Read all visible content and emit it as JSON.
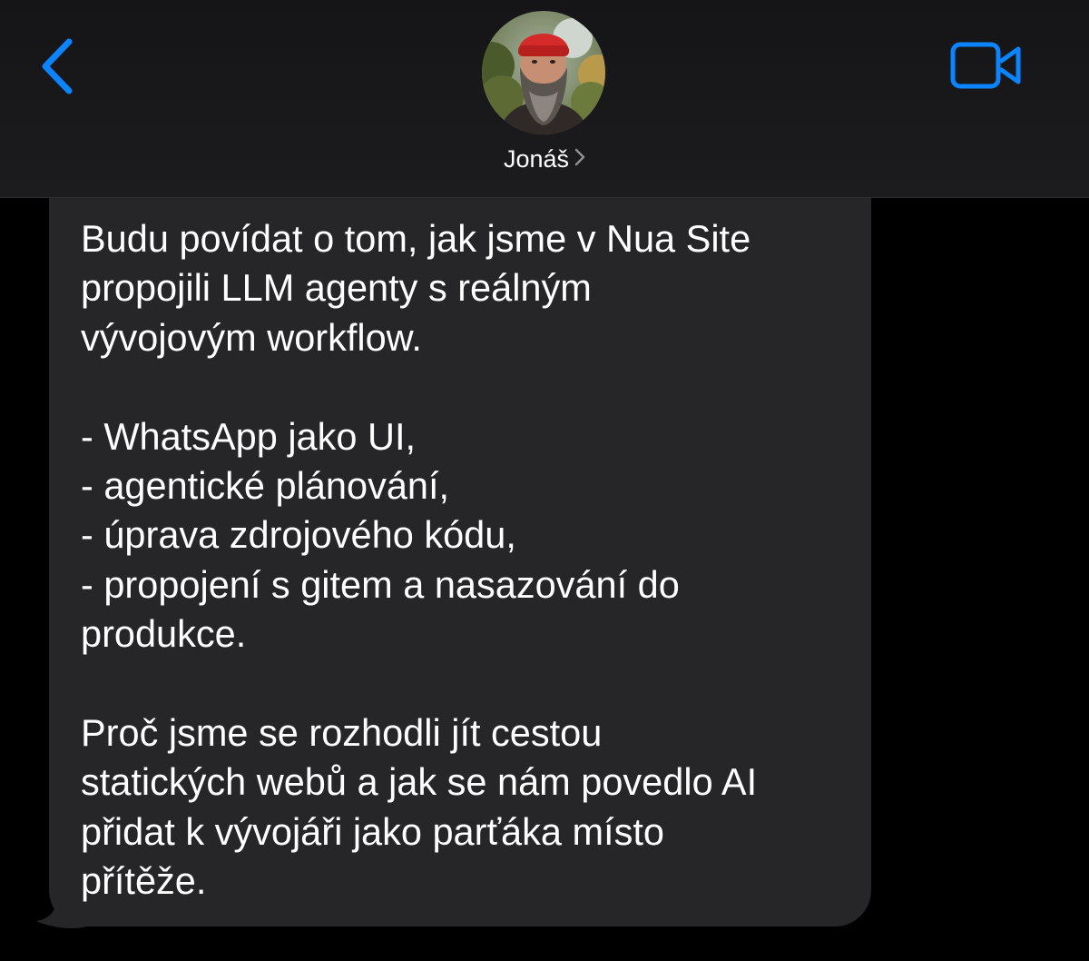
{
  "header": {
    "contact_name": "Jonáš",
    "back_icon": "chevron-left-icon",
    "video_icon": "video-camera-icon",
    "accent_color": "#0a84ff"
  },
  "message": {
    "direction": "incoming",
    "bubble_color": "#262629",
    "text": "Budu povídat o tom, jak jsme v Nua Site\npropojili LLM agenty s reálným\nvývojovým workflow.\n\n- WhatsApp jako UI,\n- agentické plánování,\n- úprava zdrojového kódu,\n- propojení s gitem a nasazování do\nprodukce.\n\nProč jsme se rozhodli jít cestou\nstatických webů a jak se nám povedlo AI\npřidat k vývojáři jako parťáka místo\npřítěže."
  }
}
